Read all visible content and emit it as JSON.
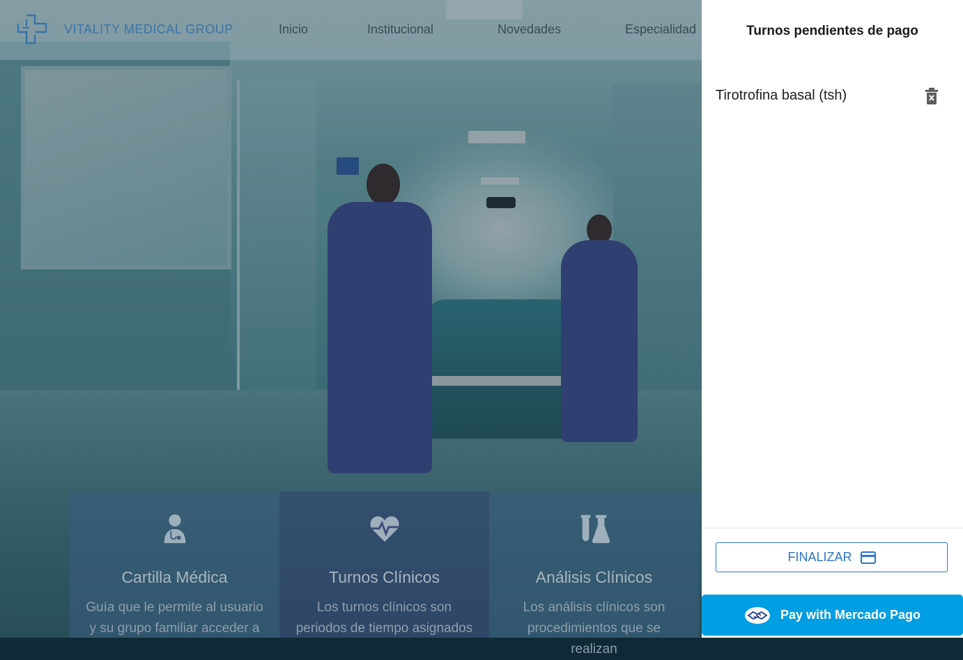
{
  "header": {
    "brand": "VITALITY MEDICAL GROUP",
    "nav": [
      "Inicio",
      "Institucional",
      "Novedades",
      "Especialidad"
    ]
  },
  "cards": [
    {
      "icon": "doctor-icon",
      "title": "Cartilla Médica",
      "desc_line1": "Guía que le permite al usuario",
      "desc_line2": "y su grupo familiar acceder a"
    },
    {
      "icon": "heartbeat-icon",
      "title": "Turnos Clínicos",
      "desc_line1": "Los turnos clínicos son",
      "desc_line2": "periodos de tiempo asignados"
    },
    {
      "icon": "flask-icon",
      "title": "Análisis Clínicos",
      "desc_line1": "Los análisis clínicos son",
      "desc_line2": "procedimientos que se realizan"
    }
  ],
  "drawer": {
    "title": "Turnos pendientes de pago",
    "items": [
      {
        "label": "Tirotrofina basal (tsh)"
      }
    ],
    "finalize_label": "FINALIZAR",
    "pay_label": "Pay with Mercado Pago"
  },
  "colors": {
    "accent_blue": "#2b74c9",
    "mercado_pago": "#009ee3"
  }
}
